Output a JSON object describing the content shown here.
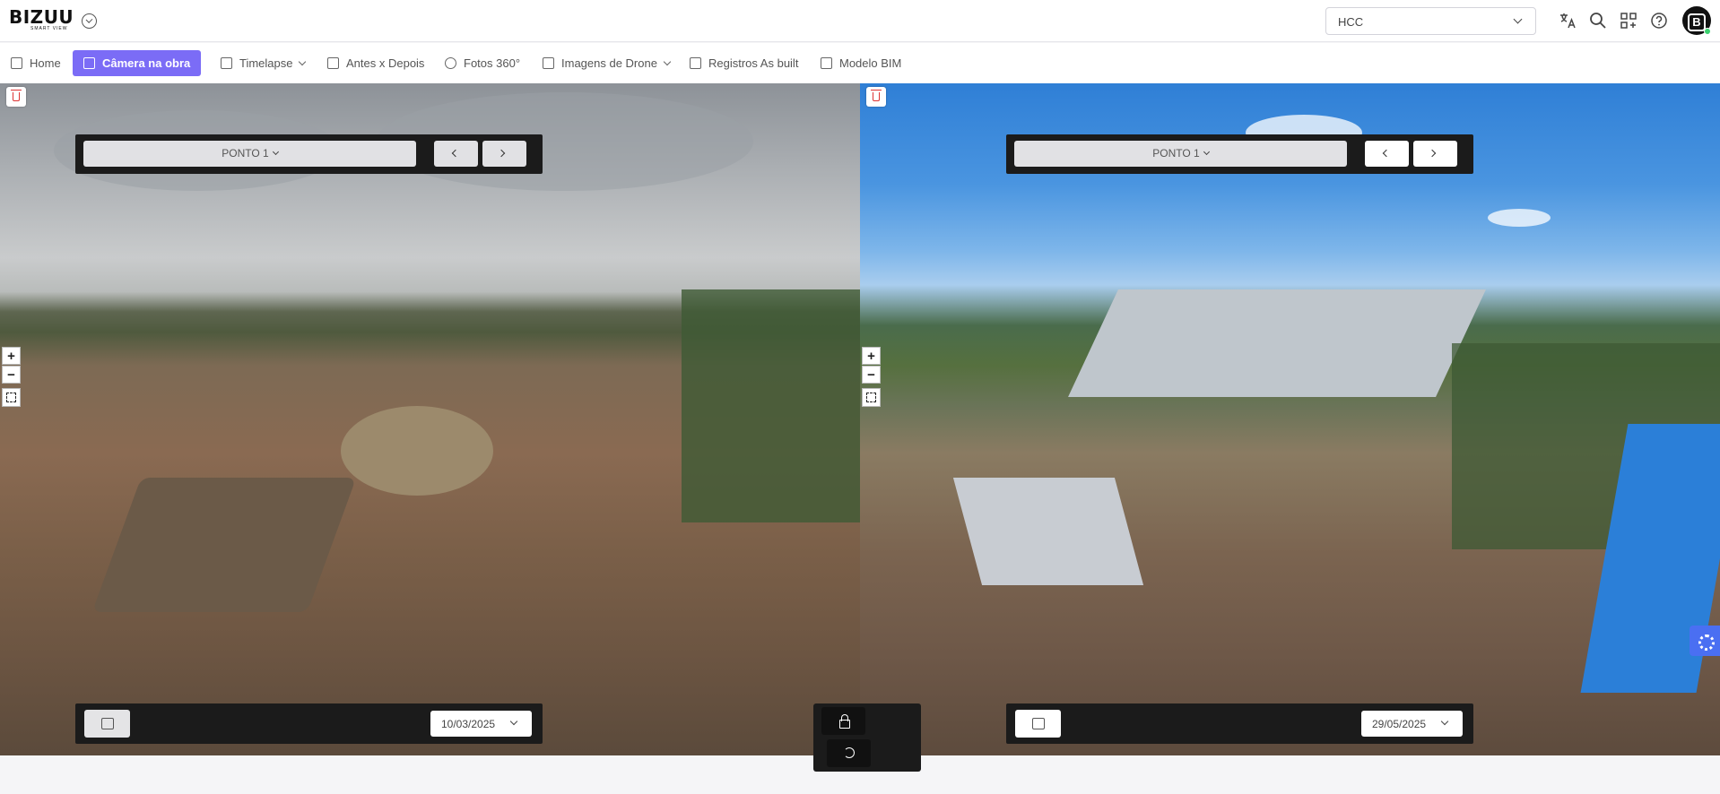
{
  "header": {
    "logo_text": "BIZUU",
    "logo_subtext": "SMART VIEW",
    "project_select": {
      "value": "HCC"
    },
    "icons": [
      "translate-icon",
      "search-icon",
      "apps-icon",
      "help-icon"
    ],
    "avatar_letter": "B"
  },
  "nav": {
    "items": [
      {
        "label": "Home",
        "icon": "home-icon",
        "active": false,
        "dropdown": false
      },
      {
        "label": "Câmera na obra",
        "icon": "video-camera-icon",
        "active": true,
        "dropdown": false
      },
      {
        "label": "Timelapse",
        "icon": "film-icon",
        "active": false,
        "dropdown": true
      },
      {
        "label": "Antes x Depois",
        "icon": "compare-icon",
        "active": false,
        "dropdown": false
      },
      {
        "label": "Fotos 360°",
        "icon": "360-icon",
        "active": false,
        "dropdown": false
      },
      {
        "label": "Imagens de Drone",
        "icon": "drone-icon",
        "active": false,
        "dropdown": true
      },
      {
        "label": "Registros As built",
        "icon": "building-icon",
        "active": false,
        "dropdown": false
      },
      {
        "label": "Modelo BIM",
        "icon": "cube-icon",
        "active": false,
        "dropdown": false
      }
    ]
  },
  "left_panel": {
    "point_select": "PONTO 1",
    "date": "10/03/2025"
  },
  "right_panel": {
    "point_select": "PONTO 1",
    "date": "29/05/2025"
  },
  "zoom": {
    "in": "+",
    "out": "−"
  },
  "colors": {
    "accent": "#7b6cf6",
    "settings_tab": "#4a6ff2",
    "control_bar": "#1b1b1b",
    "delete": "#dd3333"
  }
}
